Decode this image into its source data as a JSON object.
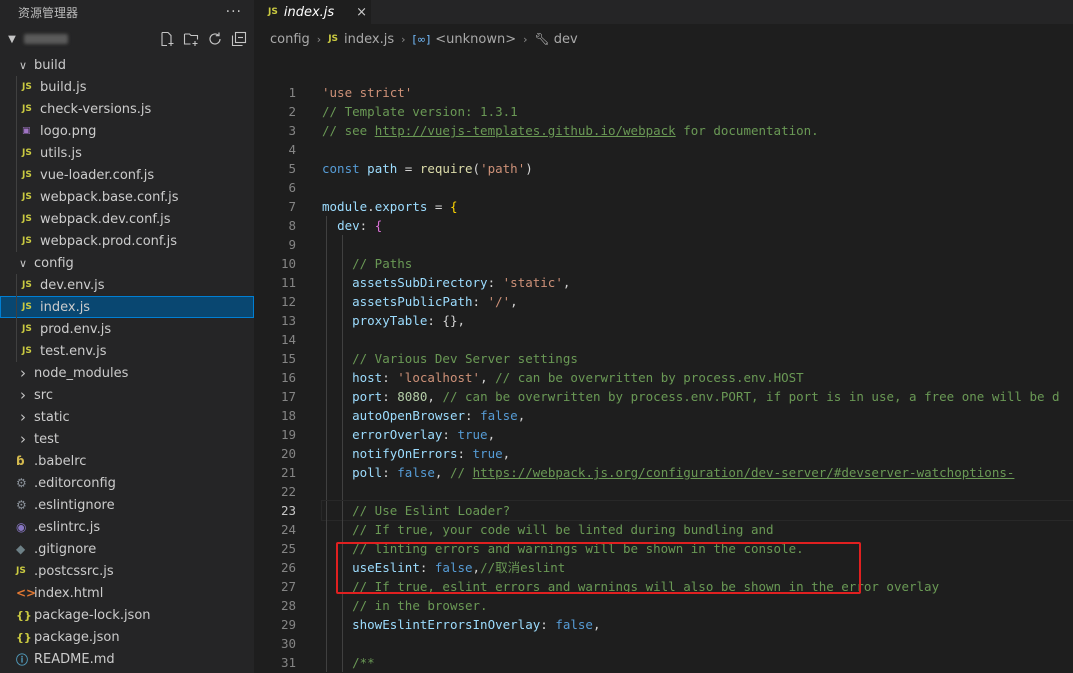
{
  "sidebar": {
    "title": "资源管理器",
    "more": "···",
    "tree": [
      {
        "label": "build",
        "type": "folder",
        "open": true,
        "depth": 1
      },
      {
        "label": "build.js",
        "type": "js",
        "depth": 2
      },
      {
        "label": "check-versions.js",
        "type": "js",
        "depth": 2
      },
      {
        "label": "logo.png",
        "type": "png",
        "depth": 2
      },
      {
        "label": "utils.js",
        "type": "js",
        "depth": 2
      },
      {
        "label": "vue-loader.conf.js",
        "type": "js",
        "depth": 2
      },
      {
        "label": "webpack.base.conf.js",
        "type": "js",
        "depth": 2
      },
      {
        "label": "webpack.dev.conf.js",
        "type": "js",
        "depth": 2
      },
      {
        "label": "webpack.prod.conf.js",
        "type": "js",
        "depth": 2
      },
      {
        "label": "config",
        "type": "folder",
        "open": true,
        "depth": 1
      },
      {
        "label": "dev.env.js",
        "type": "js",
        "depth": 2
      },
      {
        "label": "index.js",
        "type": "js",
        "depth": 2,
        "selected": true
      },
      {
        "label": "prod.env.js",
        "type": "js",
        "depth": 2
      },
      {
        "label": "test.env.js",
        "type": "js",
        "depth": 2
      },
      {
        "label": "node_modules",
        "type": "folder",
        "open": false,
        "depth": 1
      },
      {
        "label": "src",
        "type": "folder",
        "open": false,
        "depth": 1
      },
      {
        "label": "static",
        "type": "folder",
        "open": false,
        "depth": 1
      },
      {
        "label": "test",
        "type": "folder",
        "open": false,
        "depth": 1
      },
      {
        "label": ".babelrc",
        "type": "babel",
        "depth": 1
      },
      {
        "label": ".editorconfig",
        "type": "gear",
        "depth": 1
      },
      {
        "label": ".eslintignore",
        "type": "gear",
        "depth": 1
      },
      {
        "label": ".eslintrc.js",
        "type": "eslint",
        "depth": 1
      },
      {
        "label": ".gitignore",
        "type": "git",
        "depth": 1
      },
      {
        "label": ".postcssrc.js",
        "type": "js",
        "depth": 1
      },
      {
        "label": "index.html",
        "type": "html",
        "depth": 1
      },
      {
        "label": "package-lock.json",
        "type": "json",
        "depth": 1
      },
      {
        "label": "package.json",
        "type": "json",
        "depth": 1
      },
      {
        "label": "README.md",
        "type": "info",
        "depth": 1
      }
    ]
  },
  "tab": {
    "icon": "JS",
    "label": "index.js",
    "close": "×"
  },
  "breadcrumb": {
    "folder": "config",
    "file": "index.js",
    "symbol_icon": "[∞]",
    "symbol": "<unknown>",
    "member": "dev",
    "file_icon": "JS"
  },
  "editor": {
    "active_line": 23,
    "lines": [
      {
        "n": 1,
        "indent": 0,
        "tokens": [
          [
            "str",
            "'use strict'"
          ]
        ]
      },
      {
        "n": 2,
        "indent": 0,
        "tokens": [
          [
            "com",
            "// Template version: 1.3.1"
          ]
        ]
      },
      {
        "n": 3,
        "indent": 0,
        "tokens": [
          [
            "com",
            "// see "
          ],
          [
            "url",
            "http://vuejs-templates.github.io/webpack"
          ],
          [
            "com",
            " for documentation."
          ]
        ]
      },
      {
        "n": 4,
        "indent": 0,
        "tokens": []
      },
      {
        "n": 5,
        "indent": 0,
        "tokens": [
          [
            "kw",
            "const"
          ],
          [
            "plain",
            " "
          ],
          [
            "var",
            "path"
          ],
          [
            "plain",
            " = "
          ],
          [
            "fn",
            "require"
          ],
          [
            "plain",
            "("
          ],
          [
            "str",
            "'path'"
          ],
          [
            "plain",
            ")"
          ]
        ]
      },
      {
        "n": 6,
        "indent": 0,
        "tokens": []
      },
      {
        "n": 7,
        "indent": 0,
        "tokens": [
          [
            "var",
            "module"
          ],
          [
            "plain",
            "."
          ],
          [
            "var",
            "exports"
          ],
          [
            "plain",
            " = "
          ],
          [
            "brk",
            "{"
          ]
        ]
      },
      {
        "n": 8,
        "indent": 1,
        "tokens": [
          [
            "prop",
            "dev"
          ],
          [
            "plain",
            ": "
          ],
          [
            "brk2",
            "{"
          ]
        ]
      },
      {
        "n": 9,
        "indent": 2,
        "tokens": []
      },
      {
        "n": 10,
        "indent": 2,
        "tokens": [
          [
            "com",
            "// Paths"
          ]
        ]
      },
      {
        "n": 11,
        "indent": 2,
        "tokens": [
          [
            "prop",
            "assetsSubDirectory"
          ],
          [
            "plain",
            ": "
          ],
          [
            "str",
            "'static'"
          ],
          [
            "plain",
            ","
          ]
        ]
      },
      {
        "n": 12,
        "indent": 2,
        "tokens": [
          [
            "prop",
            "assetsPublicPath"
          ],
          [
            "plain",
            ": "
          ],
          [
            "str",
            "'/'"
          ],
          [
            "plain",
            ","
          ]
        ]
      },
      {
        "n": 13,
        "indent": 2,
        "tokens": [
          [
            "prop",
            "proxyTable"
          ],
          [
            "plain",
            ": {},"
          ]
        ]
      },
      {
        "n": 14,
        "indent": 2,
        "tokens": []
      },
      {
        "n": 15,
        "indent": 2,
        "tokens": [
          [
            "com",
            "// Various Dev Server settings"
          ]
        ]
      },
      {
        "n": 16,
        "indent": 2,
        "tokens": [
          [
            "prop",
            "host"
          ],
          [
            "plain",
            ": "
          ],
          [
            "str",
            "'localhost'"
          ],
          [
            "plain",
            ", "
          ],
          [
            "com",
            "// can be overwritten by process.env.HOST"
          ]
        ]
      },
      {
        "n": 17,
        "indent": 2,
        "tokens": [
          [
            "prop",
            "port"
          ],
          [
            "plain",
            ": "
          ],
          [
            "num",
            "8080"
          ],
          [
            "plain",
            ", "
          ],
          [
            "com",
            "// can be overwritten by process.env.PORT, if port is in use, a free one will be d"
          ]
        ]
      },
      {
        "n": 18,
        "indent": 2,
        "tokens": [
          [
            "prop",
            "autoOpenBrowser"
          ],
          [
            "plain",
            ": "
          ],
          [
            "kw",
            "false"
          ],
          [
            "plain",
            ","
          ]
        ]
      },
      {
        "n": 19,
        "indent": 2,
        "tokens": [
          [
            "prop",
            "errorOverlay"
          ],
          [
            "plain",
            ": "
          ],
          [
            "kw",
            "true"
          ],
          [
            "plain",
            ","
          ]
        ]
      },
      {
        "n": 20,
        "indent": 2,
        "tokens": [
          [
            "prop",
            "notifyOnErrors"
          ],
          [
            "plain",
            ": "
          ],
          [
            "kw",
            "true"
          ],
          [
            "plain",
            ","
          ]
        ]
      },
      {
        "n": 21,
        "indent": 2,
        "tokens": [
          [
            "prop",
            "poll"
          ],
          [
            "plain",
            ": "
          ],
          [
            "kw",
            "false"
          ],
          [
            "plain",
            ", "
          ],
          [
            "com",
            "// "
          ],
          [
            "url",
            "https://webpack.js.org/configuration/dev-server/#devserver-watchoptions-"
          ]
        ]
      },
      {
        "n": 22,
        "indent": 2,
        "tokens": []
      },
      {
        "n": 23,
        "indent": 2,
        "tokens": [
          [
            "com",
            "// Use Eslint Loader?"
          ]
        ]
      },
      {
        "n": 24,
        "indent": 2,
        "tokens": [
          [
            "com",
            "// If true, your code will be linted during bundling and"
          ]
        ]
      },
      {
        "n": 25,
        "indent": 2,
        "tokens": [
          [
            "com",
            "// linting errors and warnings will be shown in the console."
          ]
        ]
      },
      {
        "n": 26,
        "indent": 2,
        "tokens": [
          [
            "prop",
            "useEslint"
          ],
          [
            "plain",
            ": "
          ],
          [
            "kw",
            "false"
          ],
          [
            "plain",
            ","
          ],
          [
            "com",
            "//取消eslint"
          ]
        ]
      },
      {
        "n": 27,
        "indent": 2,
        "tokens": [
          [
            "com",
            "// If true, eslint errors and warnings will also be shown in the error overlay"
          ]
        ]
      },
      {
        "n": 28,
        "indent": 2,
        "tokens": [
          [
            "com",
            "// in the browser."
          ]
        ]
      },
      {
        "n": 29,
        "indent": 2,
        "tokens": [
          [
            "prop",
            "showEslintErrorsInOverlay"
          ],
          [
            "plain",
            ": "
          ],
          [
            "kw",
            "false"
          ],
          [
            "plain",
            ","
          ]
        ]
      },
      {
        "n": 30,
        "indent": 2,
        "tokens": []
      },
      {
        "n": 31,
        "indent": 2,
        "tokens": [
          [
            "com",
            "/**"
          ]
        ]
      }
    ]
  },
  "colors": {
    "highlight_box": "#e02020",
    "selection": "#094771",
    "js_icon": "#cbcb41",
    "comment": "#6a9955",
    "string": "#ce9178",
    "keyword": "#569cd6"
  }
}
